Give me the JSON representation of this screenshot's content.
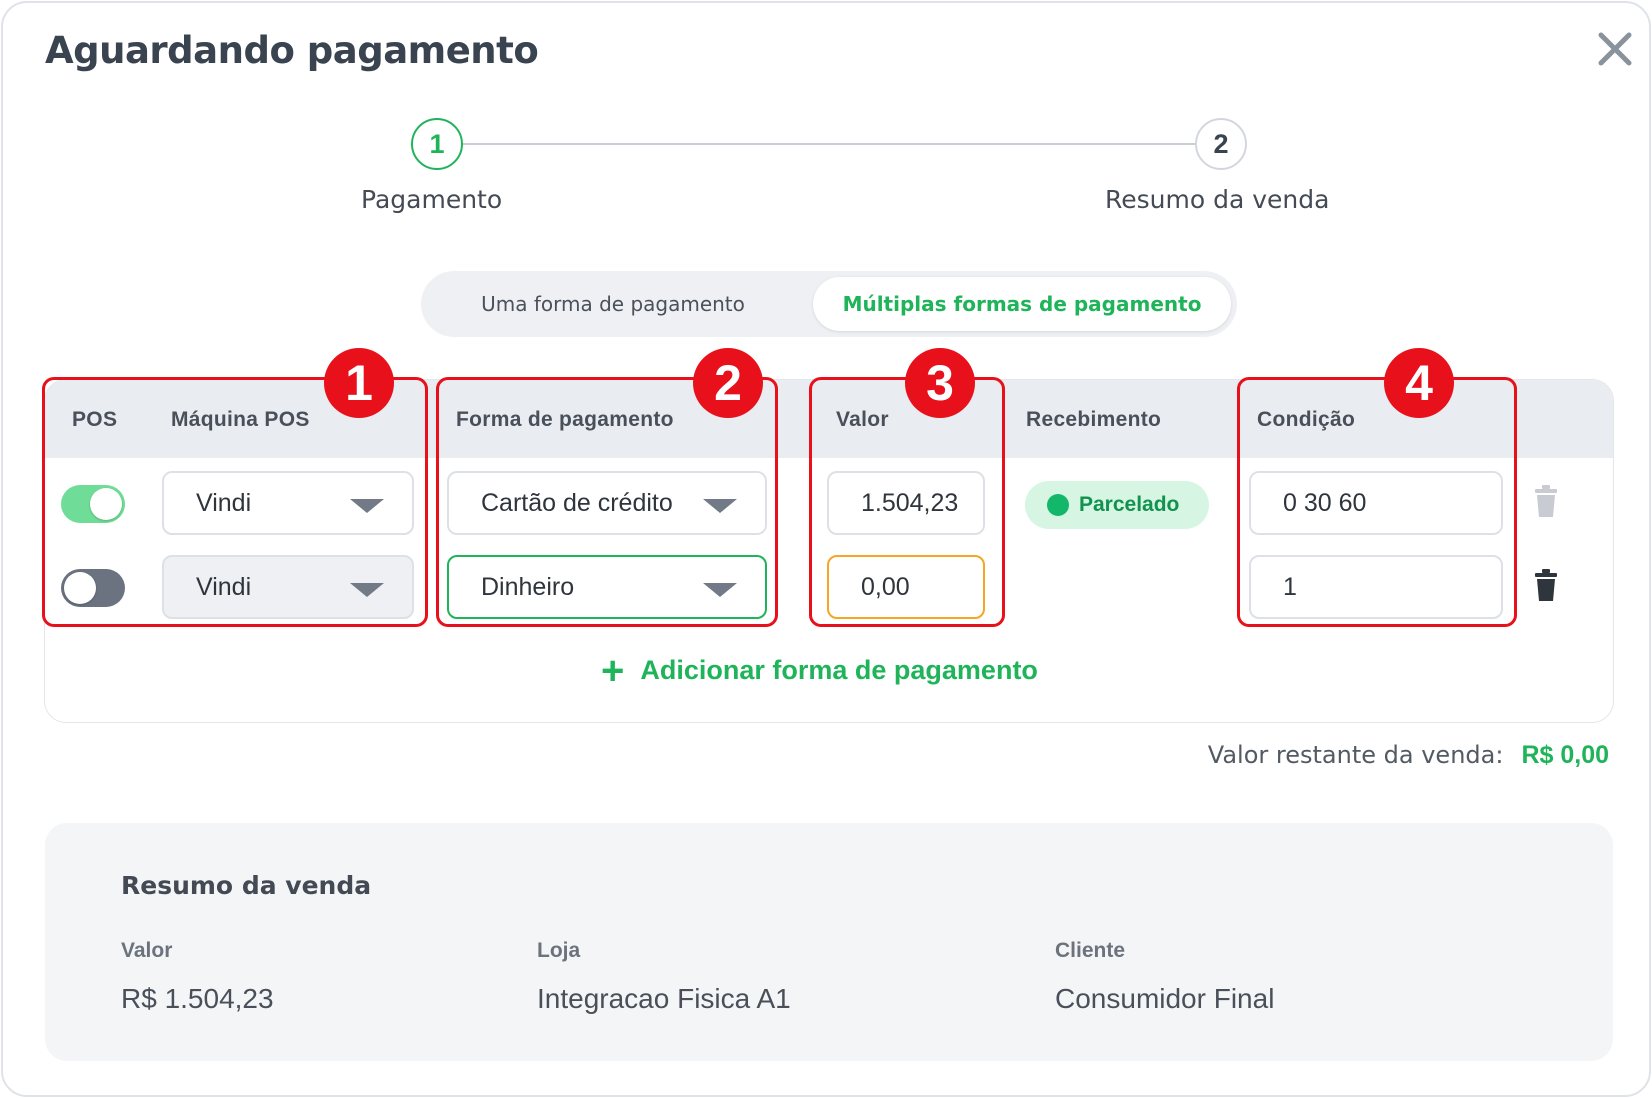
{
  "modal": {
    "title": "Aguardando pagamento"
  },
  "stepper": {
    "steps": [
      {
        "number": "1",
        "label": "Pagamento"
      },
      {
        "number": "2",
        "label": "Resumo da venda"
      }
    ]
  },
  "payment_mode": {
    "options": [
      "Uma forma de pagamento",
      "Múltiplas formas de pagamento"
    ],
    "selected": "Múltiplas formas de pagamento"
  },
  "table": {
    "headers": {
      "pos": "POS",
      "machine": "Máquina POS",
      "method": "Forma de pagamento",
      "value": "Valor",
      "receipt": "Recebimento",
      "condition": "Condição"
    },
    "rows": [
      {
        "pos_enabled": true,
        "machine": "Vindi",
        "method": "Cartão de crédito",
        "value": "1.504,23",
        "receipt": "Parcelado",
        "condition": "0 30 60"
      },
      {
        "pos_enabled": false,
        "machine": "Vindi",
        "method": "Dinheiro",
        "value": "0,00",
        "receipt": "",
        "condition": "1"
      }
    ],
    "add_button": "Adicionar forma de pagamento",
    "add_icon": "plus-icon",
    "delete_icon": "trash-icon"
  },
  "annotations": [
    "1",
    "2",
    "3",
    "4"
  ],
  "remaining": {
    "label": "Valor restante da venda:",
    "value": "R$ 0,00"
  },
  "summary": {
    "title": "Resumo da venda",
    "fields": [
      {
        "label": "Valor",
        "value": "R$ 1.504,23"
      },
      {
        "label": "Loja",
        "value": "Integracao Fisica A1"
      },
      {
        "label": "Cliente",
        "value": "Consumidor Final"
      }
    ]
  },
  "colors": {
    "accent_green": "#1fb45a",
    "annotation_red": "#e8101a",
    "focus_orange": "#f5a623"
  }
}
